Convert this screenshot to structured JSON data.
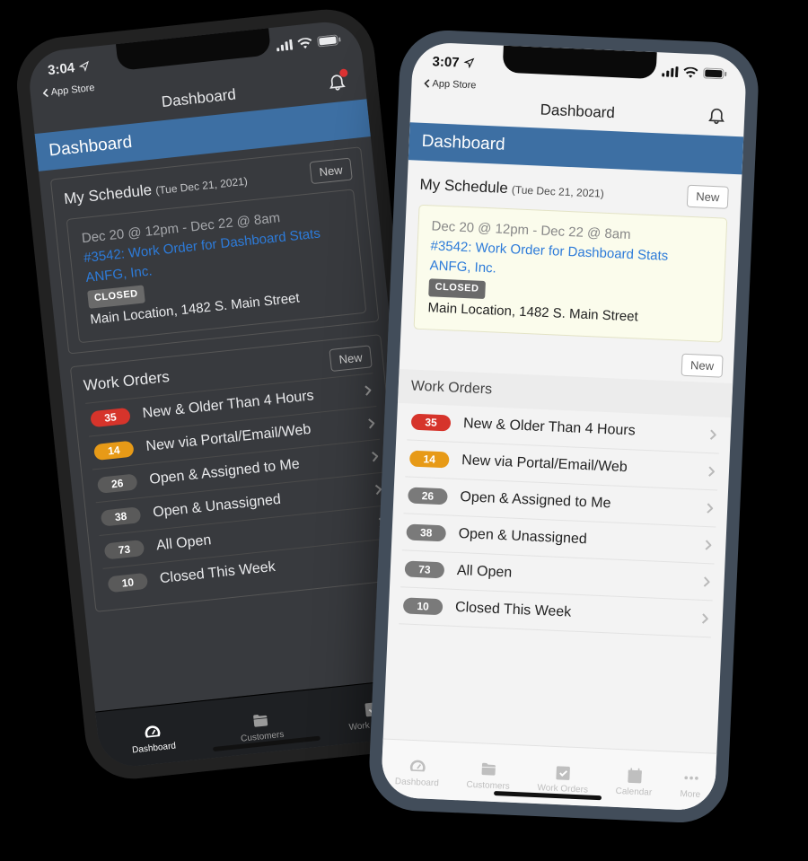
{
  "colors": {
    "brand": "#3d6fa3",
    "link": "#2d7bd9",
    "red": "#d6342b",
    "orange": "#e79a17",
    "grey": "#7a7a7a"
  },
  "dark": {
    "status_time": "3:04",
    "back_label": "App Store",
    "nav_title": "Dashboard",
    "page_title": "Dashboard",
    "bell_has_dot": true,
    "schedule": {
      "title": "My Schedule",
      "subtitle": "(Tue Dec 21, 2021)",
      "new_label": "New",
      "item": {
        "timespan": "Dec 20 @ 12pm - Dec 22 @ 8am",
        "link1": "#3542: Work Order for Dashboard Stats",
        "link2": "ANFG, Inc.",
        "status": "CLOSED",
        "address": "Main Location, 1482 S. Main Street"
      }
    },
    "work_orders": {
      "title": "Work Orders",
      "new_label": "New",
      "rows": [
        {
          "count": 35,
          "color": "red",
          "label": "New & Older Than 4 Hours"
        },
        {
          "count": 14,
          "color": "orange",
          "label": "New via Portal/Email/Web"
        },
        {
          "count": 26,
          "color": "grey",
          "label": "Open & Assigned to Me"
        },
        {
          "count": 38,
          "color": "grey",
          "label": "Open & Unassigned"
        },
        {
          "count": 73,
          "color": "grey",
          "label": "All Open"
        },
        {
          "count": 10,
          "color": "grey",
          "label": "Closed This Week"
        }
      ]
    },
    "tabs": [
      {
        "label": "Dashboard",
        "icon": "gauge",
        "active": true
      },
      {
        "label": "Customers",
        "icon": "folder",
        "active": false
      },
      {
        "label": "Work Orders",
        "icon": "checkbox",
        "active": false
      }
    ]
  },
  "light": {
    "status_time": "3:07",
    "back_label": "App Store",
    "nav_title": "Dashboard",
    "page_title": "Dashboard",
    "bell_has_dot": false,
    "schedule": {
      "title": "My Schedule",
      "subtitle": "(Tue Dec 21, 2021)",
      "new_label": "New",
      "item": {
        "timespan": "Dec 20 @ 12pm - Dec 22 @ 8am",
        "link1": "#3542: Work Order for Dashboard Stats",
        "link2": "ANFG, Inc.",
        "status": "CLOSED",
        "address": "Main Location, 1482 S. Main Street"
      }
    },
    "work_orders": {
      "title": "Work Orders",
      "new_label": "New",
      "rows": [
        {
          "count": 35,
          "color": "red",
          "label": "New & Older Than 4 Hours"
        },
        {
          "count": 14,
          "color": "orange",
          "label": "New via Portal/Email/Web"
        },
        {
          "count": 26,
          "color": "grey",
          "label": "Open & Assigned to Me"
        },
        {
          "count": 38,
          "color": "grey",
          "label": "Open & Unassigned"
        },
        {
          "count": 73,
          "color": "grey",
          "label": "All Open"
        },
        {
          "count": 10,
          "color": "grey",
          "label": "Closed This Week"
        }
      ]
    },
    "tabs": [
      {
        "label": "Dashboard",
        "icon": "gauge",
        "active": false
      },
      {
        "label": "Customers",
        "icon": "folder",
        "active": false
      },
      {
        "label": "Work Orders",
        "icon": "checkbox",
        "active": false
      },
      {
        "label": "Calendar",
        "icon": "calendar",
        "active": false
      },
      {
        "label": "More",
        "icon": "dots",
        "active": false
      }
    ]
  }
}
